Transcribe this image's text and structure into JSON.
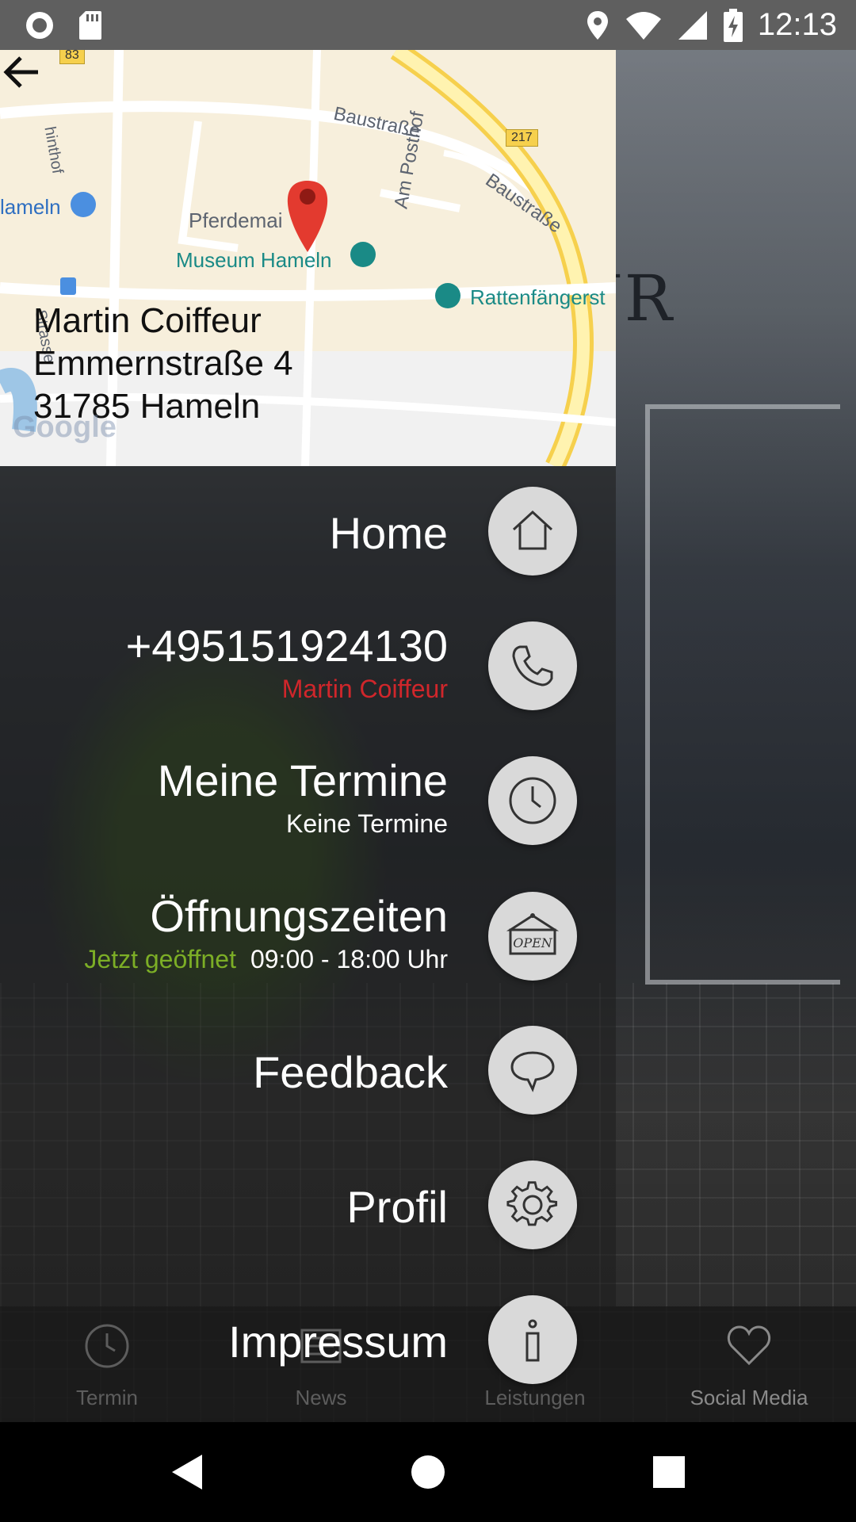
{
  "status_bar": {
    "time": "12:13",
    "icons": [
      "record-icon",
      "sd-card-icon",
      "location-icon",
      "wifi-icon",
      "signal-icon",
      "battery-charging-icon"
    ]
  },
  "map": {
    "labels": {
      "baustrasse1": "Baustraße",
      "baustrasse2": "Baustraße",
      "am_posthof": "Am Posthof",
      "pferdemarkt": "Pferdemai",
      "museum": "Museum Hameln",
      "rattenfaenger": "Rattenfängerst",
      "hameln_poi": "lameln",
      "road_217": "217",
      "road_83": "83",
      "hinthof": "hinthof",
      "strasse": "Strasse"
    },
    "logo_text": "Google",
    "address": {
      "name": "Martin Coiffeur",
      "street": "Emmernstraße 4",
      "city": "31785 Hameln"
    }
  },
  "menu": {
    "home": {
      "title": "Home"
    },
    "phone": {
      "title": "+495151924130",
      "subtitle": "Martin Coiffeur",
      "subtitle_color": "#d0262b"
    },
    "appointments": {
      "title": "Meine Termine",
      "subtitle": "Keine Termine"
    },
    "opening": {
      "title": "Öffnungszeiten",
      "status": "Jetzt geöffnet",
      "status_color": "#7cae26",
      "hours": "09:00 - 18:00 Uhr"
    },
    "feedback": {
      "title": "Feedback"
    },
    "profile": {
      "title": "Profil"
    },
    "imprint": {
      "title": "Impressum"
    }
  },
  "tabs": [
    {
      "label": "Termin",
      "icon": "clock-icon"
    },
    {
      "label": "News",
      "icon": "news-icon"
    },
    {
      "label": "Leistungen",
      "icon": "scissors-icon"
    },
    {
      "label": "Social Media",
      "icon": "heart-icon"
    }
  ],
  "shop_sign": "EUR",
  "colors": {
    "status_bar": "#5f5f5f",
    "circle": "#d9d9d9",
    "accent_red": "#d0262b",
    "accent_green": "#7cae26"
  }
}
